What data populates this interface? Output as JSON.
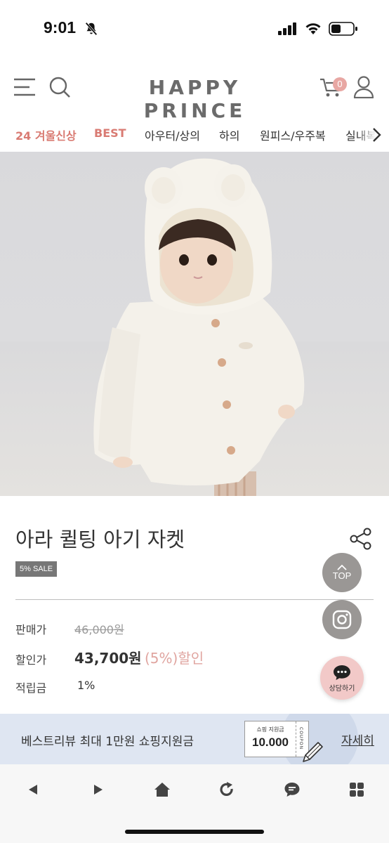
{
  "status_bar": {
    "time": "9:01",
    "icons": [
      "bell-slash-icon",
      "signal-icon",
      "wifi-icon",
      "battery-icon"
    ]
  },
  "header": {
    "logo": "HAPPY PRINCE",
    "cart_count": "0",
    "icons": [
      "menu-icon",
      "search-icon",
      "cart-icon",
      "user-icon"
    ]
  },
  "categories": [
    {
      "label": "24 겨울신상",
      "accent": true
    },
    {
      "label": "BEST",
      "accent": true
    },
    {
      "label": "아우터/상의",
      "accent": false
    },
    {
      "label": "하의",
      "accent": false
    },
    {
      "label": "원피스/우주복",
      "accent": false
    },
    {
      "label": "실내복",
      "accent": false
    }
  ],
  "product": {
    "title": "아라 퀼팅 아기 자켓",
    "sale_badge": "5% SALE",
    "price_label": "판매가",
    "original_price": "46,000원",
    "discount_label": "할인가",
    "sale_price": "43,700원",
    "discount_rate": "(5%)",
    "discount_suffix": "할인",
    "points_label": "적립금",
    "points_value": "1%"
  },
  "floating": {
    "top_label": "TOP",
    "chat_label": "상담하기"
  },
  "promo": {
    "text": "베스트리뷰 최대 1만원 쇼핑지원금",
    "coupon_title": "쇼핑 지원금",
    "coupon_amount": "10.000",
    "coupon_side": "COUPON",
    "details_link": "자세히"
  },
  "colors": {
    "accent": "#d97b73",
    "discount": "#e0a5a0",
    "banner_bg": "#dfe6f2",
    "float_gray": "#9a9795",
    "chat_pink": "#f2c9c8"
  },
  "toolbar_icons": [
    "back-icon",
    "forward-icon",
    "home-icon",
    "refresh-icon",
    "chat-icon",
    "grid-icon"
  ]
}
